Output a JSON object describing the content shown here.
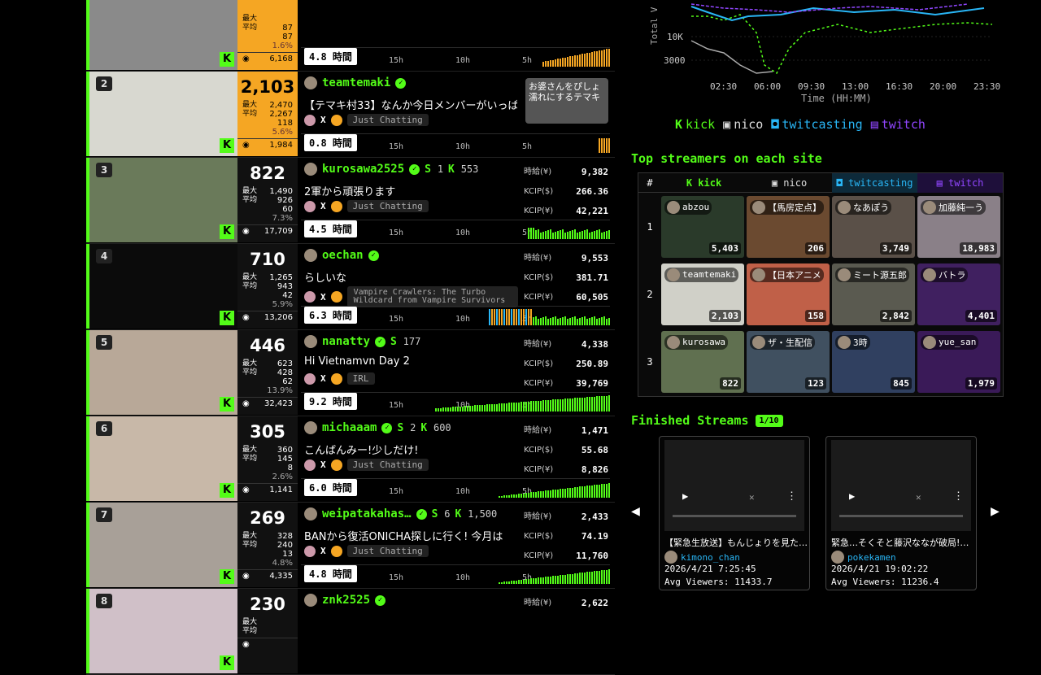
{
  "rows": [
    {
      "rank": "",
      "viewers": "",
      "max": "",
      "avg": "87",
      "chat": "87",
      "pct": "1.6%",
      "total": "6,168",
      "user": "",
      "check": false,
      "title": "",
      "tag": "",
      "hours": "4.8 時間",
      "jp": [
        "",
        "",
        ""
      ],
      "cols": [
        "",
        "",
        ""
      ],
      "hl": true,
      "bars": "yellow",
      "photo": "#8a8a8a"
    },
    {
      "rank": "2",
      "viewers": "2,103",
      "max": "2,470",
      "avg": "2,267",
      "chat": "118",
      "pct": "5.6%",
      "total": "1,984",
      "user": "teamtemaki",
      "check": true,
      "follows": "",
      "title": "【テマキ村33】なんか今日メンバーがいっぱい",
      "tag": "Just Chatting",
      "hours": "0.8 時間",
      "jp": [
        "",
        "",
        ""
      ],
      "cols": [
        "",
        "",
        ""
      ],
      "hl": true,
      "bars": "yellow-short",
      "photo": "#d8d8d0",
      "overlay": "お婆さんをぴしょ濡れにするテマキ"
    },
    {
      "rank": "3",
      "viewers": "822",
      "max": "1,490",
      "avg": "926",
      "chat": "60",
      "pct": "7.3%",
      "total": "17,709",
      "user": "kurosawa2525",
      "check": true,
      "sf": "1",
      "kf": "553",
      "title": "2軍から頑張ります",
      "tag": "Just Chatting",
      "hours": "4.5 時間",
      "jp": [
        "時給(¥)",
        "KCIP($)",
        "KCIP(¥)"
      ],
      "cols": [
        "9,382",
        "266.36",
        "42,221"
      ],
      "hl": false,
      "bars": "green",
      "photo": "#6a7a5a"
    },
    {
      "rank": "4",
      "viewers": "710",
      "max": "1,265",
      "avg": "943",
      "chat": "42",
      "pct": "5.9%",
      "total": "13,206",
      "user": "oechan",
      "check": true,
      "title": "らしいな",
      "tag": "Vampire Crawlers: The Turbo Wildcard from Vampire Survivors",
      "hours": "6.3 時間",
      "jp": [
        "時給(¥)",
        "KCIP($)",
        "KCIP(¥)"
      ],
      "cols": [
        "9,553",
        "381.71",
        "60,505"
      ],
      "hl": false,
      "bars": "mixed",
      "photo": "#0b0b0b"
    },
    {
      "rank": "5",
      "viewers": "446",
      "max": "623",
      "avg": "428",
      "chat": "62",
      "pct": "13.9%",
      "total": "32,423",
      "user": "nanatty",
      "check": true,
      "sf": "177",
      "title": "Hi Vietnamvn Day 2",
      "tag": "IRL",
      "hours": "9.2 時間",
      "jp": [
        "時給(¥)",
        "KCIP($)",
        "KCIP(¥)"
      ],
      "cols": [
        "4,338",
        "250.89",
        "39,769"
      ],
      "hl": false,
      "bars": "green-full",
      "photo": "#b8a898"
    },
    {
      "rank": "6",
      "viewers": "305",
      "max": "360",
      "avg": "145",
      "chat": "8",
      "pct": "2.6%",
      "total": "1,141",
      "user": "michaaam",
      "check": true,
      "sf": "2",
      "kf": "600",
      "title": "こんばんみー!少しだけ!",
      "tag": "Just Chatting",
      "hours": "6.0 時間",
      "jp": [
        "時給(¥)",
        "KCIP($)",
        "KCIP(¥)"
      ],
      "cols": [
        "1,471",
        "55.68",
        "8,826"
      ],
      "hl": false,
      "bars": "green-late",
      "photo": "#c8b8a8"
    },
    {
      "rank": "7",
      "viewers": "269",
      "max": "328",
      "avg": "240",
      "chat": "13",
      "pct": "4.8%",
      "total": "4,335",
      "user": "weipatakahas…",
      "check": true,
      "sf": "6",
      "kf": "1,500",
      "title": "BANから復活ONICHA探しに行く! 今月は",
      "tag": "Just Chatting",
      "hours": "4.8 時間",
      "jp": [
        "時給(¥)",
        "KCIP($)",
        "KCIP(¥)"
      ],
      "cols": [
        "2,433",
        "74.19",
        "11,760"
      ],
      "hl": false,
      "bars": "green-late",
      "photo": "#a8a098"
    },
    {
      "rank": "8",
      "viewers": "230",
      "max": "",
      "avg": "",
      "chat": "",
      "pct": "",
      "total": "",
      "user": "znk2525",
      "check": true,
      "title": "",
      "tag": "",
      "hours": "",
      "jp": [
        "時給(¥)",
        "",
        ""
      ],
      "cols": [
        "2,622",
        "",
        ""
      ],
      "hl": false,
      "bars": "none",
      "photo": "#d0c0c8"
    }
  ],
  "time_labels": [
    "15h",
    "10h",
    "5h"
  ],
  "stat_labels": {
    "max": "最大",
    "avg": "平均"
  },
  "chart": {
    "ylabel": "Total V",
    "xlabel": "Time (HH:MM)",
    "yticks": [
      "10K",
      "3000"
    ],
    "xticks": [
      "02:30",
      "06:00",
      "09:30",
      "13:00",
      "16:30",
      "20:00",
      "23:30"
    ]
  },
  "legend": {
    "kick": "kick",
    "nico": "nico",
    "twitcasting": "twitcasting",
    "twitch": "twitch"
  },
  "top_title": "Top streamers on each site",
  "top_head": {
    "num": "#",
    "kick": "kick",
    "nico": "nico",
    "twitcasting": "twitcasting",
    "twitch": "twitch"
  },
  "top": [
    {
      "n": "1",
      "cells": [
        {
          "name": "abzou",
          "v": "5,403",
          "bg": "#2a3a2a"
        },
        {
          "name": "【馬房定点】",
          "v": "206",
          "bg": "#6b4a30"
        },
        {
          "name": "なあぽう",
          "v": "3,749",
          "bg": "#5a5048"
        },
        {
          "name": "加藤純一う",
          "v": "18,983",
          "bg": "#8a8088"
        }
      ]
    },
    {
      "n": "2",
      "cells": [
        {
          "name": "teamtemaki",
          "v": "2,103",
          "bg": "#d0d0c8"
        },
        {
          "name": "【日本アニメ",
          "v": "158",
          "bg": "#c06048"
        },
        {
          "name": "ミート源五郎",
          "v": "2,842",
          "bg": "#5a5a50"
        },
        {
          "name": "バトラ",
          "v": "4,401",
          "bg": "#402060"
        }
      ]
    },
    {
      "n": "3",
      "cells": [
        {
          "name": "kurosawa",
          "v": "822",
          "bg": "#607050"
        },
        {
          "name": "ザ・生配信",
          "v": "123",
          "bg": "#405060"
        },
        {
          "name": "3時",
          "v": "845",
          "bg": "#304060"
        },
        {
          "name": "yue_san",
          "v": "1,979",
          "bg": "#3a1a58"
        }
      ]
    }
  ],
  "fin_title": "Finished Streams",
  "fin_badge": "1/10",
  "cards": [
    {
      "title": "【緊急生放送】もんじょりを見た…",
      "user": "kimono_chan",
      "date": "2026/4/21 7:25:45",
      "viewers": "Avg Viewers: 11433.7"
    },
    {
      "title": "緊急…そくそと藤沢ななが破局!…",
      "user": "pokekamen",
      "date": "2026/4/21 19:02:22",
      "viewers": "Avg Viewers: 11236.4"
    }
  ],
  "colors": {
    "kick": "#53fc18",
    "twitcasting": "#29b6f6",
    "twitch": "#9146ff",
    "highlight": "#f5a623"
  }
}
